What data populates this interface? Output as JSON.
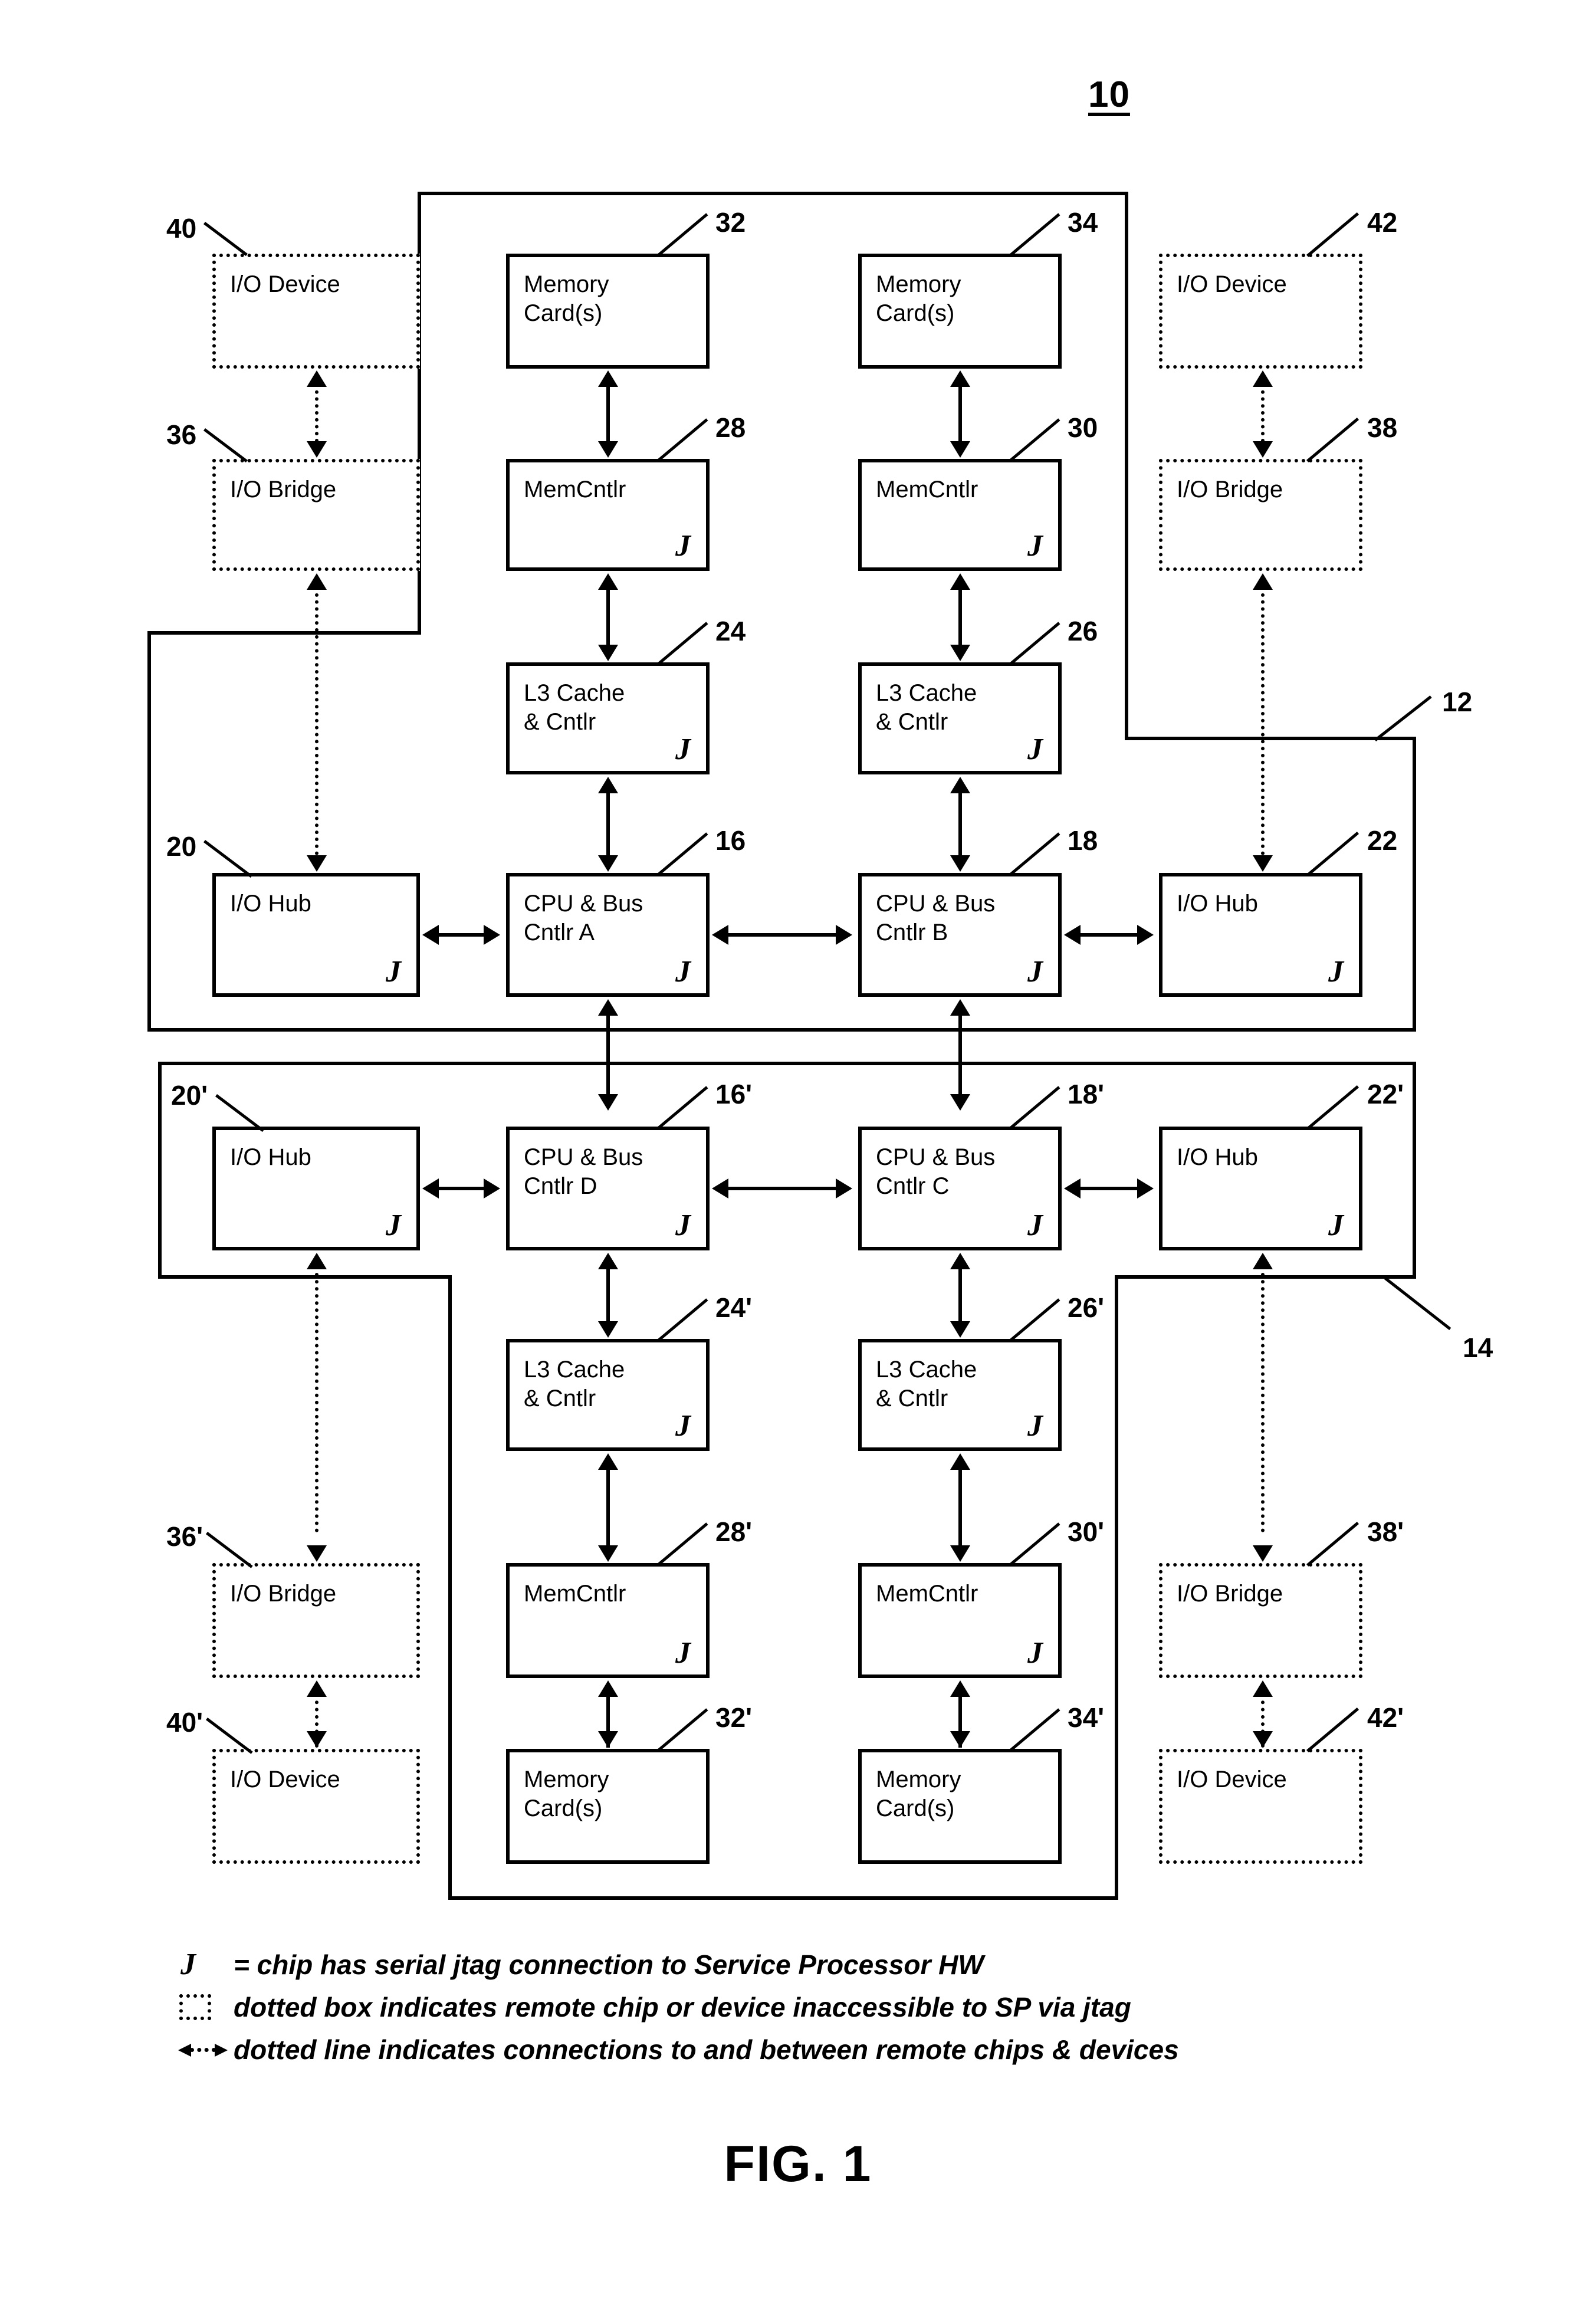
{
  "figure": {
    "top_reference": "10",
    "caption": "FIG. 1"
  },
  "groups": [
    {
      "id": "node-12",
      "ref": "12"
    },
    {
      "id": "node-14",
      "ref": "14"
    }
  ],
  "boxes": [
    {
      "id": "io-device-40",
      "label": "I/O Device",
      "ref": "40",
      "style": "dotted",
      "jtag": ""
    },
    {
      "id": "mem-cards-32",
      "label": "Memory\nCard(s)",
      "ref": "32",
      "style": "solid",
      "jtag": ""
    },
    {
      "id": "mem-cards-34",
      "label": "Memory\nCard(s)",
      "ref": "34",
      "style": "solid",
      "jtag": ""
    },
    {
      "id": "io-device-42",
      "label": "I/O Device",
      "ref": "42",
      "style": "dotted",
      "jtag": ""
    },
    {
      "id": "io-bridge-36",
      "label": "I/O Bridge",
      "ref": "36",
      "style": "dotted",
      "jtag": ""
    },
    {
      "id": "memcntlr-28",
      "label": "MemCntlr",
      "ref": "28",
      "style": "solid",
      "jtag": "J"
    },
    {
      "id": "memcntlr-30",
      "label": "MemCntlr",
      "ref": "30",
      "style": "solid",
      "jtag": "J"
    },
    {
      "id": "io-bridge-38",
      "label": "I/O Bridge",
      "ref": "38",
      "style": "dotted",
      "jtag": ""
    },
    {
      "id": "l3-cache-24",
      "label": "L3 Cache\n& Cntlr",
      "ref": "24",
      "style": "solid",
      "jtag": "J"
    },
    {
      "id": "l3-cache-26",
      "label": "L3 Cache\n& Cntlr",
      "ref": "26",
      "style": "solid",
      "jtag": "J"
    },
    {
      "id": "io-hub-20",
      "label": "I/O Hub",
      "ref": "20",
      "style": "solid",
      "jtag": "J"
    },
    {
      "id": "cpu-bus-16",
      "label": "CPU & Bus\nCntlr A",
      "ref": "16",
      "style": "solid",
      "jtag": "J"
    },
    {
      "id": "cpu-bus-18",
      "label": "CPU & Bus\nCntlr B",
      "ref": "18",
      "style": "solid",
      "jtag": "J"
    },
    {
      "id": "io-hub-22",
      "label": "I/O Hub",
      "ref": "22",
      "style": "solid",
      "jtag": "J"
    },
    {
      "id": "io-hub-20p",
      "label": "I/O Hub",
      "ref": "20'",
      "style": "solid",
      "jtag": "J"
    },
    {
      "id": "cpu-bus-16p",
      "label": "CPU & Bus\nCntlr D",
      "ref": "16'",
      "style": "solid",
      "jtag": "J"
    },
    {
      "id": "cpu-bus-18p",
      "label": "CPU & Bus\nCntlr C",
      "ref": "18'",
      "style": "solid",
      "jtag": "J"
    },
    {
      "id": "io-hub-22p",
      "label": "I/O Hub",
      "ref": "22'",
      "style": "solid",
      "jtag": "J"
    },
    {
      "id": "l3-cache-24p",
      "label": "L3 Cache\n& Cntlr",
      "ref": "24'",
      "style": "solid",
      "jtag": "J"
    },
    {
      "id": "l3-cache-26p",
      "label": "L3 Cache\n& Cntlr",
      "ref": "26'",
      "style": "solid",
      "jtag": "J"
    },
    {
      "id": "io-bridge-36p",
      "label": "I/O Bridge",
      "ref": "36'",
      "style": "dotted",
      "jtag": ""
    },
    {
      "id": "memcntlr-28p",
      "label": "MemCntlr",
      "ref": "28'",
      "style": "solid",
      "jtag": "J"
    },
    {
      "id": "memcntlr-30p",
      "label": "MemCntlr",
      "ref": "30'",
      "style": "solid",
      "jtag": "J"
    },
    {
      "id": "io-bridge-38p",
      "label": "I/O Bridge",
      "ref": "38'",
      "style": "dotted",
      "jtag": ""
    },
    {
      "id": "io-device-40p",
      "label": "I/O Device",
      "ref": "40'",
      "style": "dotted",
      "jtag": ""
    },
    {
      "id": "mem-cards-32p",
      "label": "Memory\nCard(s)",
      "ref": "32'",
      "style": "solid",
      "jtag": ""
    },
    {
      "id": "mem-cards-34p",
      "label": "Memory\nCard(s)",
      "ref": "34'",
      "style": "solid",
      "jtag": ""
    },
    {
      "id": "io-device-42p",
      "label": "I/O Device",
      "ref": "42'",
      "style": "dotted",
      "jtag": ""
    }
  ],
  "legend": {
    "jtag_glyph": "J",
    "lines": [
      "= chip has serial jtag connection to Service Processor HW",
      "dotted box indicates remote chip or device inaccessible to SP via jtag",
      "dotted line indicates connections to and between remote chips & devices"
    ]
  },
  "colors": {
    "ink": "#000000",
    "paper": "#ffffff"
  }
}
